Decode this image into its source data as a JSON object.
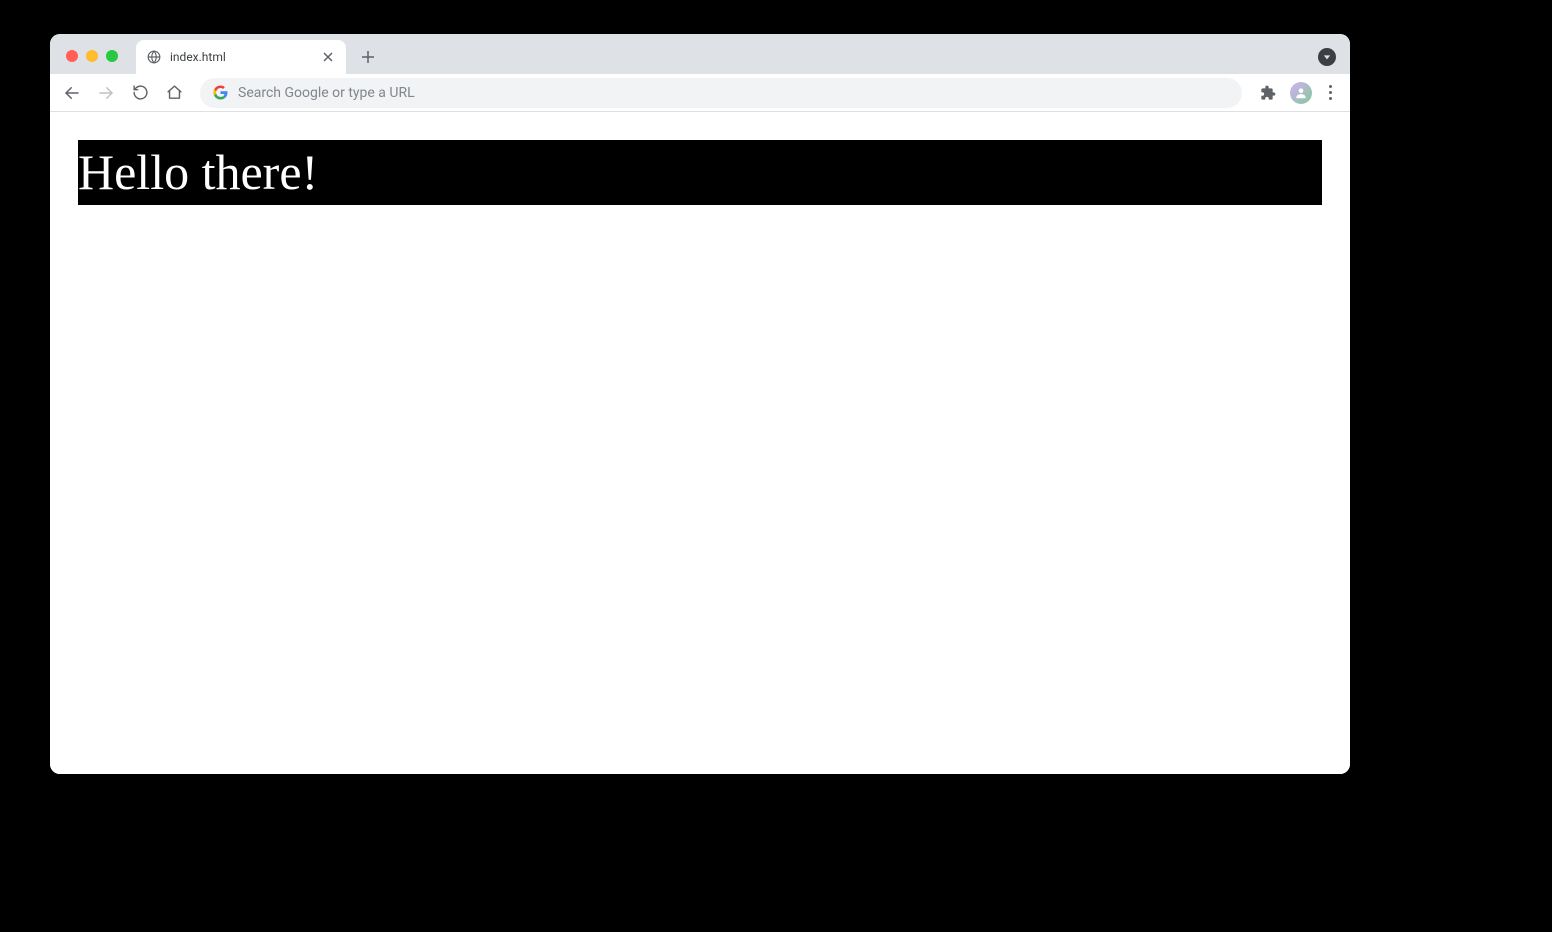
{
  "tab": {
    "title": "index.html"
  },
  "omnibox": {
    "placeholder": "Search Google or type a URL"
  },
  "page": {
    "heading": "Hello there!"
  }
}
